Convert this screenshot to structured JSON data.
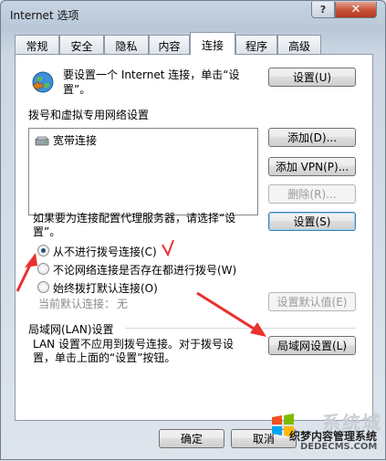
{
  "window": {
    "title": "Internet 选项",
    "help_label": "?",
    "close_label": "✕"
  },
  "tabs": [
    {
      "label": "常规"
    },
    {
      "label": "安全"
    },
    {
      "label": "隐私"
    },
    {
      "label": "内容"
    },
    {
      "label": "连接",
      "active": true
    },
    {
      "label": "程序"
    },
    {
      "label": "高级"
    }
  ],
  "setup": {
    "text_line1": "要设置一个 Internet 连接，单击“设",
    "text_line2": "置”。",
    "button": "设置(U)"
  },
  "dialup": {
    "heading": "拨号和虚拟专用网络设置",
    "connections": [
      {
        "name": "宽带连接"
      }
    ],
    "add_button": "添加(D)...",
    "add_vpn_button": "添加 VPN(P)...",
    "remove_button": "删除(R)...",
    "proxy_text_line1": "如果要为连接配置代理服务器，请选择“设",
    "proxy_text_line2": "置”。",
    "settings_button": "设置(S)",
    "radio_options": [
      {
        "label": "从不进行拨号连接(C)",
        "checked": true
      },
      {
        "label": "不论网络连接是否存在都进行拨号(W)",
        "checked": false
      },
      {
        "label": "始终拨打默认连接(O)",
        "checked": false
      }
    ],
    "current_default_label": "当前默认连接：",
    "current_default_value": "无",
    "set_default_button": "设置默认值(E)"
  },
  "lan": {
    "heading": "局域网(LAN)设置",
    "text_line1": "LAN 设置不应用到拨号连接。对于拨号设",
    "text_line2": "置，单击上面的“设置”按钮。",
    "button": "局域网设置(L)"
  },
  "footer": {
    "ok_button": "确定",
    "cancel_button": "取消"
  },
  "annotations": {
    "arrow_color": "#e8312f"
  },
  "watermark": {
    "site": "织梦内容管理系统",
    "url": "DEDECMS.COM",
    "brand": "系统城"
  }
}
